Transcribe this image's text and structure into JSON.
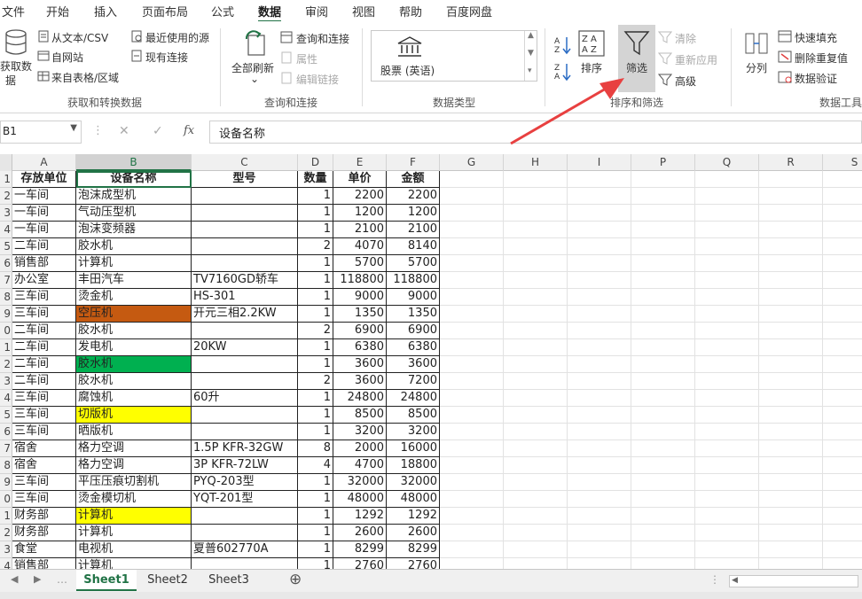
{
  "menu": {
    "tabs": [
      "文件",
      "开始",
      "插入",
      "页面布局",
      "公式",
      "数据",
      "审阅",
      "视图",
      "帮助",
      "百度网盘"
    ],
    "active_index": 5
  },
  "ribbon": {
    "get_data": {
      "big_button_line1": "获取数",
      "big_button_line2": "据",
      "from_text": "从文本/CSV",
      "from_web": "自网站",
      "from_table": "来自表格/区域",
      "recent_sources": "最近使用的源",
      "existing_connections": "现有连接",
      "group_label": "获取和转换数据"
    },
    "queries": {
      "refresh_all": "全部刷新",
      "queries_connections": "查询和连接",
      "properties": "属性",
      "edit_links": "编辑链接",
      "group_label": "查询和连接"
    },
    "data_types": {
      "stock_label": "股票 (英语)",
      "group_label": "数据类型"
    },
    "sort_filter": {
      "sort": "排序",
      "filter": "筛选",
      "clear": "清除",
      "reapply": "重新应用",
      "advanced": "高级",
      "group_label": "排序和筛选"
    },
    "data_tools": {
      "split": "分列",
      "flash_fill": "快速填充",
      "remove_duplicates": "删除重复值",
      "data_validation": "数据验证",
      "group_label": "数据工具"
    }
  },
  "formula_bar": {
    "name_box": "B1",
    "cancel_symbol": "✕",
    "enter_symbol": "✓",
    "fx_symbol": "fx",
    "content": "设备名称"
  },
  "columns": [
    "A",
    "B",
    "C",
    "D",
    "E",
    "F",
    "G",
    "H",
    "I",
    "P",
    "Q",
    "R",
    "S"
  ],
  "row_numbers": [
    "1",
    "2",
    "3",
    "4",
    "5",
    "6",
    "7",
    "8",
    "9",
    "0",
    "1",
    "2",
    "3",
    "4",
    "5",
    "6",
    "7",
    "8",
    "9",
    "0",
    "1",
    "2",
    "3",
    "4"
  ],
  "table": {
    "headers": [
      "存放单位",
      "设备名称",
      "型号",
      "数量",
      "单价",
      "金额"
    ],
    "rows": [
      [
        "一车间",
        "泡沫成型机",
        "",
        "1",
        "2200",
        "2200"
      ],
      [
        "一车间",
        "气动压型机",
        "",
        "1",
        "1200",
        "1200"
      ],
      [
        "一车间",
        "泡沫变频器",
        "",
        "1",
        "2100",
        "2100"
      ],
      [
        "二车间",
        "胶水机",
        "",
        "2",
        "4070",
        "8140"
      ],
      [
        "销售部",
        "计算机",
        "",
        "1",
        "5700",
        "5700"
      ],
      [
        "办公室",
        "丰田汽车",
        "TV7160GD轿车",
        "1",
        "118800",
        "118800"
      ],
      [
        "三车间",
        "烫金机",
        "HS-301",
        "1",
        "9000",
        "9000"
      ],
      [
        "三车间",
        "空压机",
        "开元三相2.2KW",
        "1",
        "1350",
        "1350"
      ],
      [
        "二车间",
        "胶水机",
        "",
        "2",
        "6900",
        "6900"
      ],
      [
        "二车间",
        "发电机",
        "20KW",
        "1",
        "6380",
        "6380"
      ],
      [
        "二车间",
        "胶水机",
        "",
        "1",
        "3600",
        "3600"
      ],
      [
        "二车间",
        "胶水机",
        "",
        "2",
        "3600",
        "7200"
      ],
      [
        "三车间",
        "腐蚀机",
        "60升",
        "1",
        "24800",
        "24800"
      ],
      [
        "三车间",
        "切版机",
        "",
        "1",
        "8500",
        "8500"
      ],
      [
        "三车间",
        "晒版机",
        "",
        "1",
        "3200",
        "3200"
      ],
      [
        "宿舍",
        "格力空调",
        "1.5P KFR-32GW",
        "8",
        "2000",
        "16000"
      ],
      [
        "宿舍",
        "格力空调",
        "3P KFR-72LW",
        "4",
        "4700",
        "18800"
      ],
      [
        "三车间",
        "平压压痕切割机",
        "PYQ-203型",
        "1",
        "32000",
        "32000"
      ],
      [
        "三车间",
        "烫金模切机",
        "YQT-201型",
        "1",
        "48000",
        "48000"
      ],
      [
        "财务部",
        "计算机",
        "",
        "1",
        "1292",
        "1292"
      ],
      [
        "财务部",
        "计算机",
        "",
        "1",
        "2600",
        "2600"
      ],
      [
        "食堂",
        "电视机",
        "夏普602770A",
        "1",
        "8299",
        "8299"
      ],
      [
        "销售部",
        "计算机",
        "",
        "1",
        "2760",
        "2760"
      ]
    ],
    "highlights": {
      "7": "#c55a11",
      "10": "#00b050",
      "13": "#ffff00",
      "19": "#ffff00"
    }
  },
  "sheets": {
    "tabs": [
      "Sheet1",
      "Sheet2",
      "Sheet3"
    ],
    "active_index": 0,
    "add_symbol": "⊕"
  },
  "colors": {
    "accent": "#217346",
    "arrow": "#e84040"
  }
}
